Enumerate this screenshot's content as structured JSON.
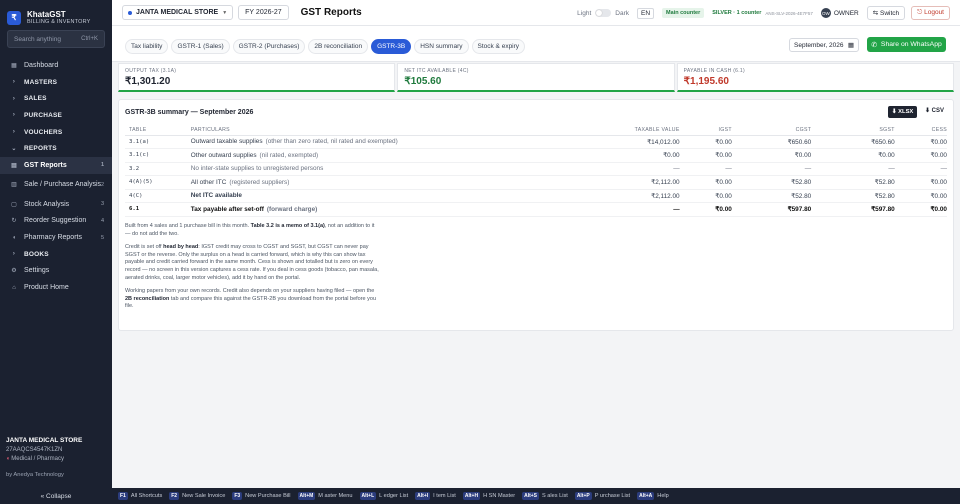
{
  "app": {
    "name": "KhataGST",
    "subtitle": "BILLING & INVENTORY",
    "logo": "₹"
  },
  "search": {
    "placeholder": "Search anything",
    "shortcut": "Ctrl+K"
  },
  "nav": [
    {
      "label": "Dashboard",
      "icon": "grid-icon",
      "type": "item"
    },
    {
      "label": "MASTERS",
      "icon": "chevron-right-icon",
      "type": "section"
    },
    {
      "label": "SALES",
      "icon": "chevron-right-icon",
      "type": "section"
    },
    {
      "label": "PURCHASE",
      "icon": "chevron-right-icon",
      "type": "section"
    },
    {
      "label": "VOUCHERS",
      "icon": "chevron-right-icon",
      "type": "section"
    },
    {
      "label": "REPORTS",
      "icon": "chevron-down-icon",
      "type": "section"
    },
    {
      "label": "GST Reports",
      "icon": "report-icon",
      "type": "active",
      "badge": "1"
    },
    {
      "label": "Sale / Purchase Analysis",
      "icon": "chart-icon",
      "type": "double",
      "badge": "2"
    },
    {
      "label": "Stock Analysis",
      "icon": "box-icon",
      "type": "item",
      "badge": "3"
    },
    {
      "label": "Reorder Suggestion",
      "icon": "refresh-icon",
      "type": "item",
      "badge": "4"
    },
    {
      "label": "Pharmacy Reports",
      "icon": "pill-icon",
      "type": "item",
      "badge": "5"
    },
    {
      "label": "BOOKS",
      "icon": "chevron-right-icon",
      "type": "section"
    },
    {
      "label": "Settings",
      "icon": "gear-icon",
      "type": "item"
    },
    {
      "label": "Product Home",
      "icon": "home-icon",
      "type": "item"
    }
  ],
  "sidebar_footer": {
    "company": "JANTA MEDICAL STORE",
    "gstin": "27AAQCS4547K1ZN",
    "type": "Medical / Pharmacy",
    "by": "by Anedya Technology",
    "collapse": "« Collapse"
  },
  "topbar": {
    "store": "JANTA MEDICAL STORE",
    "fy": "FY 2026-27",
    "title": "GST Reports",
    "light": "Light",
    "dark": "Dark",
    "lang": "EN",
    "counter": "Main counter",
    "license": "SILVER · 1 counter",
    "license_id": "ANS-SLV-2026-4E7F57",
    "avatar": "OW",
    "user": "OWNER",
    "switch": "⇆ Switch",
    "logout": "⎋ Logout"
  },
  "tabs": [
    "Tax liability",
    "GSTR-1 (Sales)",
    "GSTR-2 (Purchases)",
    "2B reconciliation",
    "GSTR-3B",
    "HSN summary",
    "Stock & expiry"
  ],
  "active_tab": 4,
  "period": "September, 2026",
  "whatsapp_label": "Share on WhatsApp",
  "summary_cards": [
    {
      "label": "OUTPUT TAX (3.1A)",
      "value": "₹1,301.20",
      "color": "#1f2430"
    },
    {
      "label": "NET ITC AVAILABLE (4C)",
      "value": "₹105.60",
      "color": "#1f7a3d"
    },
    {
      "label": "PAYABLE IN CASH (6.1)",
      "value": "₹1,195.60",
      "color": "#c0392b"
    }
  ],
  "panel": {
    "title": "GSTR-3B summary — September 2026",
    "xlsx": "⬇ XLSX",
    "csv": "⬇ CSV"
  },
  "table": {
    "headers": [
      "TABLE",
      "PARTICULARS",
      "TAXABLE VALUE",
      "IGST",
      "CGST",
      "SGST",
      "CESS"
    ],
    "rows": [
      {
        "code": "3.1(a)",
        "particulars": "Outward taxable supplies",
        "sub": "(other than zero rated, nil rated and exempted)",
        "taxable": "₹14,012.00",
        "igst": "₹0.00",
        "cgst": "₹650.60",
        "sgst": "₹650.60",
        "cess": "₹0.00"
      },
      {
        "code": "3.1(c)",
        "particulars": "Other outward supplies",
        "sub": "(nil rated, exempted)",
        "taxable": "₹0.00",
        "igst": "₹0.00",
        "cgst": "₹0.00",
        "sgst": "₹0.00",
        "cess": "₹0.00"
      },
      {
        "code": "3.2",
        "particulars": "No inter-state supplies to unregistered persons",
        "sub": "",
        "taxable": "—",
        "igst": "—",
        "cgst": "—",
        "sgst": "—",
        "cess": "—"
      },
      {
        "code": "4(A)(5)",
        "particulars": "All other ITC",
        "sub": "(registered suppliers)",
        "taxable": "₹2,112.00",
        "igst": "₹0.00",
        "cgst": "₹52.80",
        "sgst": "₹52.80",
        "cess": "₹0.00"
      },
      {
        "code": "4(C)",
        "particulars": "Net ITC available",
        "sub": "",
        "taxable": "₹2,112.00",
        "igst": "₹0.00",
        "cgst": "₹52.80",
        "sgst": "₹52.80",
        "cess": "₹0.00"
      },
      {
        "code": "6.1",
        "particulars": "Tax payable after set-off",
        "sub": "(forward charge)",
        "taxable": "—",
        "igst": "₹0.00",
        "cgst": "₹597.80",
        "sgst": "₹597.80",
        "cess": "₹0.00"
      }
    ]
  },
  "notes": {
    "p1a": "Built from 4 sales and 1 purchase bill in this month. ",
    "p1b": "Table 3.2 is a memo of 3.1(a)",
    "p1c": ", not an addition to it — do not add the two.",
    "p2a": "Credit is set off ",
    "p2b": "head by head",
    "p2c": ": IGST credit may cross to CGST and SGST, but CGST can never pay SGST or the reverse. Only the surplus on a head is carried forward, which is why this can show tax payable and credit carried forward in the same month. Cess is shown and totalled but is zero on every record — no screen in this version captures a cess rate. If you deal in cess goods (tobacco, pan masala, aerated drinks, coal, larger motor vehicles), add it by hand on the portal.",
    "p3a": "Working papers from your own records. Credit also depends on your suppliers having filed — open the ",
    "p3b": "2B reconciliation",
    "p3c": " tab and compare this against the GSTR-2B you download from the portal before you file."
  },
  "shortcuts": [
    {
      "key": "F1",
      "label": "All Shortcuts"
    },
    {
      "key": "F2",
      "label": "New Sale Invoice"
    },
    {
      "key": "F3",
      "label": "New Purchase Bill"
    },
    {
      "key": "Alt+M",
      "label": "M aster Menu"
    },
    {
      "key": "Alt+L",
      "label": "L edger List"
    },
    {
      "key": "Alt+I",
      "label": "I tem List"
    },
    {
      "key": "Alt+H",
      "label": "H SN Master"
    },
    {
      "key": "Alt+S",
      "label": "S ales List"
    },
    {
      "key": "Alt+P",
      "label": "P urchase List"
    },
    {
      "key": "Alt+A",
      "label": "Help"
    }
  ]
}
